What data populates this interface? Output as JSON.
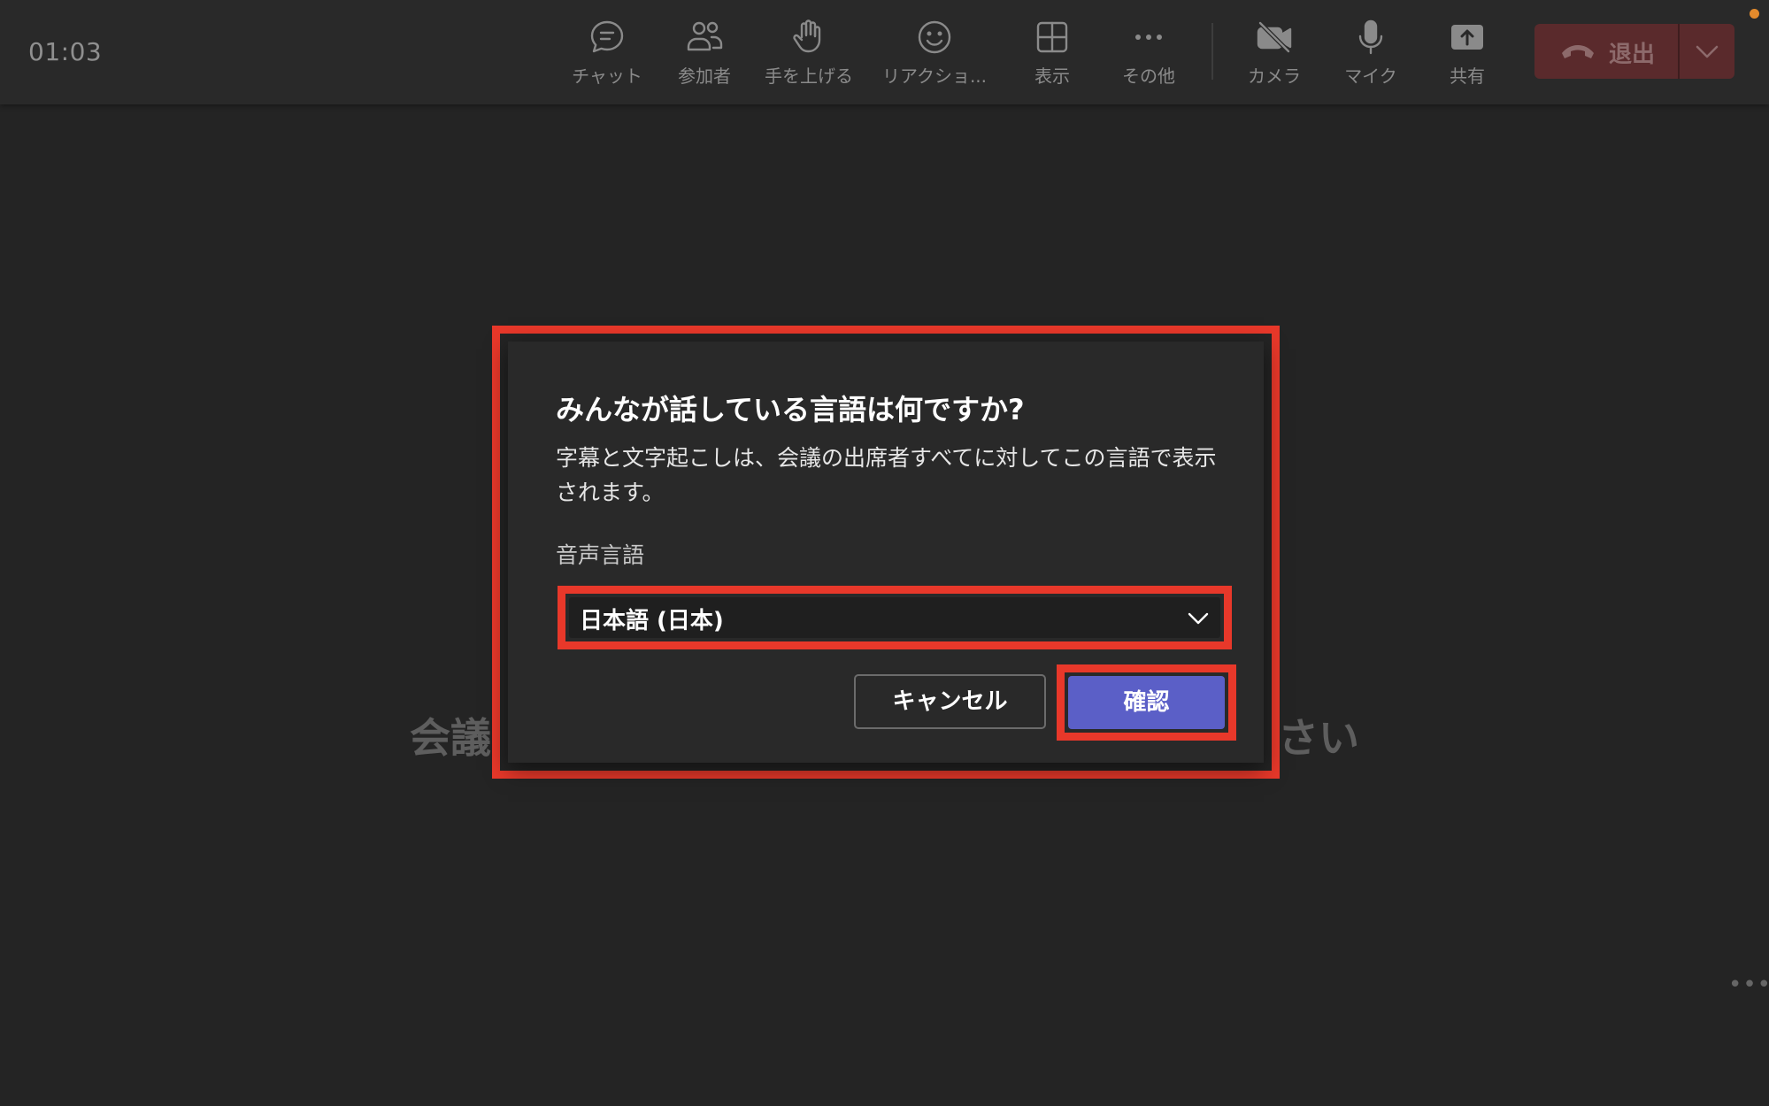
{
  "call": {
    "timer": "01:03"
  },
  "toolbar": {
    "chat": "チャット",
    "participants": "参加者",
    "raise_hand": "手を上げる",
    "reactions": "リアクショ...",
    "view": "表示",
    "more": "その他",
    "camera": "カメラ",
    "mic": "マイク",
    "share": "共有",
    "leave": "退出"
  },
  "background": {
    "message_left": "会議",
    "message_right": "さい"
  },
  "dialog": {
    "title": "みんなが話している言語は何ですか?",
    "description": "字幕と文字起こしは、会議の出席者すべてに対してこの言語で表示されます。",
    "field_label": "音声言語",
    "selected_language": "日本語 (日本)",
    "cancel_label": "キャンセル",
    "confirm_label": "確認"
  },
  "colors": {
    "highlight": "#e8382a",
    "accent": "#5b5fc7",
    "leave": "#5a2a2c",
    "notification": "#e38a2c"
  }
}
